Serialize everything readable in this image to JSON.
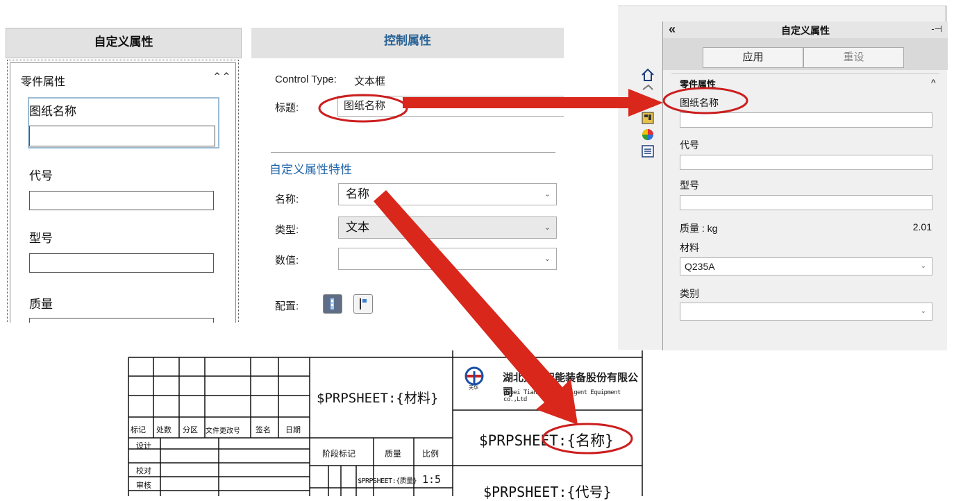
{
  "custom_props_panel": {
    "header": "自定义属性",
    "group_title": "零件属性",
    "collapse_glyph": "⌃⌃",
    "fields": [
      {
        "label": "图纸名称"
      },
      {
        "label": "代号"
      },
      {
        "label": "型号"
      },
      {
        "label": "质量"
      }
    ]
  },
  "control_props_panel": {
    "header": "控制属性",
    "control_type_label": "Control Type:",
    "control_type_value": "文本框",
    "title_label": "标题:",
    "title_value": "图纸名称",
    "section_title": "自定义属性特性",
    "name_label": "名称:",
    "name_value": "名称",
    "type_label": "类型:",
    "type_value": "文本",
    "value_label": "数值:",
    "value_value": "",
    "config_label": "配置:"
  },
  "task_pane": {
    "collapse_icon": "«",
    "title": "自定义属性",
    "pin_icon": "-⊣",
    "apply_button": "应用",
    "reset_button": "重设",
    "group_title": "零件属性",
    "group_chevron": "^",
    "fields": [
      {
        "label": "图纸名称",
        "value": ""
      },
      {
        "label": "代号",
        "value": ""
      },
      {
        "label": "型号",
        "value": ""
      }
    ],
    "mass_label": "质量 : kg",
    "mass_value": "2.01",
    "material_label": "材料",
    "material_value": "Q235A",
    "category_label": "类别",
    "category_value": ""
  },
  "title_block": {
    "material_field": "$PRPSHEET:{材料}",
    "name_field": "$PRPSHEET:{名称}",
    "code_field": "$PRPSHEET:{代号}",
    "mass_field": "$PRPSHEET:{质量}",
    "scale_value": "1:5",
    "company_cn": "湖北天华智能装备股份有限公司",
    "company_en": "Hubei Tianhua Intelligent Equipment co.,Ltd",
    "logo_sub": "天华",
    "revision_headers": [
      "标记",
      "处数",
      "分区",
      "文件更改号",
      "签名",
      "日期"
    ],
    "sign_rows": [
      "设计",
      "校对",
      "审核"
    ],
    "stage_headers": [
      "阶段标记",
      "质量",
      "比例"
    ]
  },
  "colors": {
    "arrow_red": "#d9271c",
    "ellipse_red": "#cc1e1e",
    "section_blue": "#2266aa"
  }
}
